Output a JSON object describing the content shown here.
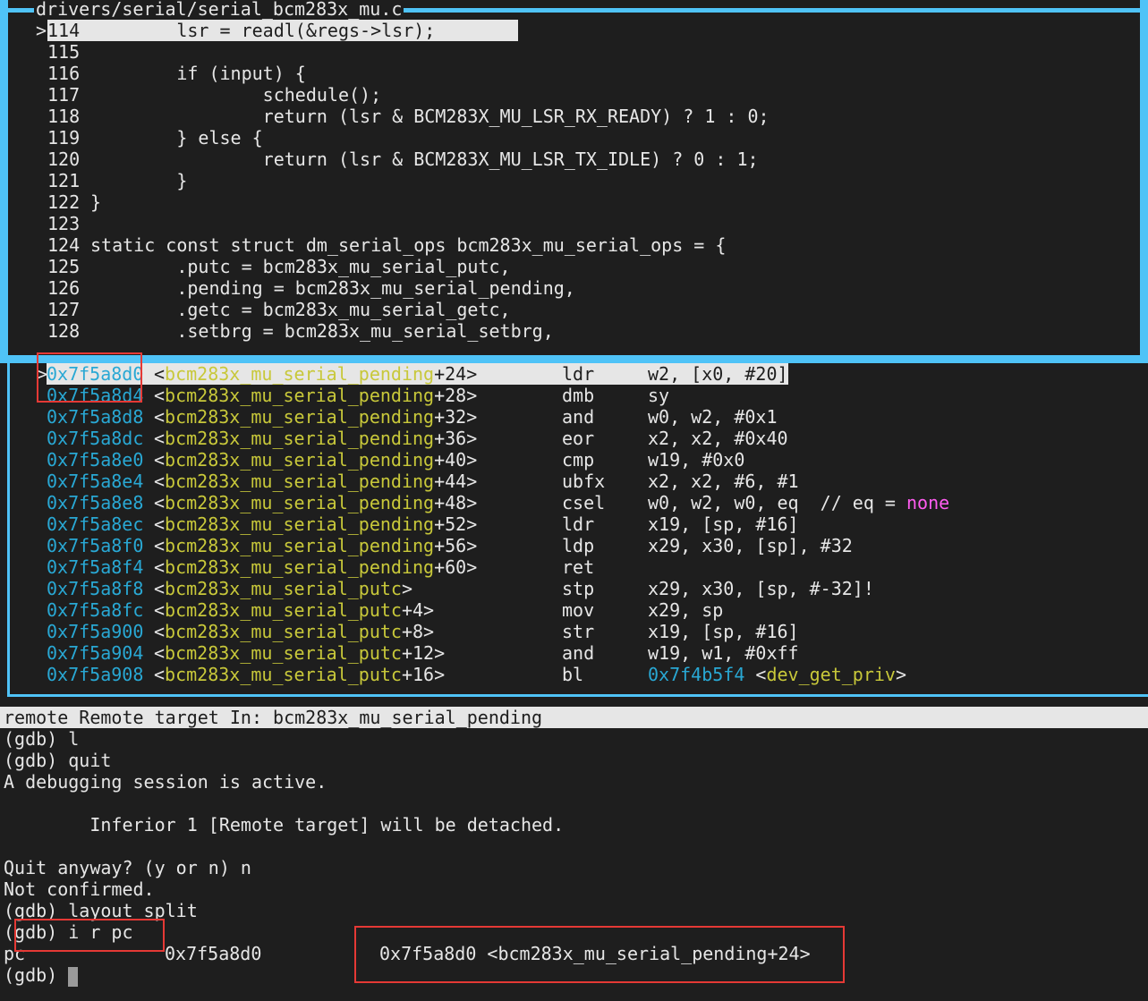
{
  "source": {
    "file": "drivers/serial/serial_bcm283x_mu.c",
    "current_marker": ">",
    "lines": [
      {
        "num": "114",
        "code": "        lsr = readl(&regs->lsr);"
      },
      {
        "num": "115",
        "code": ""
      },
      {
        "num": "116",
        "code": "        if (input) {"
      },
      {
        "num": "117",
        "code": "                schedule();"
      },
      {
        "num": "118",
        "code": "                return (lsr & BCM283X_MU_LSR_RX_READY) ? 1 : 0;"
      },
      {
        "num": "119",
        "code": "        } else {"
      },
      {
        "num": "120",
        "code": "                return (lsr & BCM283X_MU_LSR_TX_IDLE) ? 0 : 1;"
      },
      {
        "num": "121",
        "code": "        }"
      },
      {
        "num": "122",
        "code": "}"
      },
      {
        "num": "123",
        "code": ""
      },
      {
        "num": "124",
        "code": "static const struct dm_serial_ops bcm283x_mu_serial_ops = {"
      },
      {
        "num": "125",
        "code": "        .putc = bcm283x_mu_serial_putc,"
      },
      {
        "num": "126",
        "code": "        .pending = bcm283x_mu_serial_pending,"
      },
      {
        "num": "127",
        "code": "        .getc = bcm283x_mu_serial_getc,"
      },
      {
        "num": "128",
        "code": "        .setbrg = bcm283x_mu_serial_setbrg,"
      }
    ]
  },
  "asm": {
    "current_marker": ">",
    "rows": [
      {
        "addr": "0x7f5a8d0",
        "fn": "bcm283x_mu_serial_pending",
        "off": "+24>",
        "mn": "ldr",
        "op": "w2, [x0, #20]"
      },
      {
        "addr": "0x7f5a8d4",
        "fn": "bcm283x_mu_serial_pending",
        "off": "+28>",
        "mn": "dmb",
        "op": "sy"
      },
      {
        "addr": "0x7f5a8d8",
        "fn": "bcm283x_mu_serial_pending",
        "off": "+32>",
        "mn": "and",
        "op": "w0, w2, #0x1"
      },
      {
        "addr": "0x7f5a8dc",
        "fn": "bcm283x_mu_serial_pending",
        "off": "+36>",
        "mn": "eor",
        "op": "x2, x2, #0x40"
      },
      {
        "addr": "0x7f5a8e0",
        "fn": "bcm283x_mu_serial_pending",
        "off": "+40>",
        "mn": "cmp",
        "op": "w19, #0x0"
      },
      {
        "addr": "0x7f5a8e4",
        "fn": "bcm283x_mu_serial_pending",
        "off": "+44>",
        "mn": "ubfx",
        "op": "x2, x2, #6, #1"
      },
      {
        "addr": "0x7f5a8e8",
        "fn": "bcm283x_mu_serial_pending",
        "off": "+48>",
        "mn": "csel",
        "op": "w0, w2, w0, eq  // eq = ",
        "op_extra": "none"
      },
      {
        "addr": "0x7f5a8ec",
        "fn": "bcm283x_mu_serial_pending",
        "off": "+52>",
        "mn": "ldr",
        "op": "x19, [sp, #16]"
      },
      {
        "addr": "0x7f5a8f0",
        "fn": "bcm283x_mu_serial_pending",
        "off": "+56>",
        "mn": "ldp",
        "op": "x29, x30, [sp], #32"
      },
      {
        "addr": "0x7f5a8f4",
        "fn": "bcm283x_mu_serial_pending",
        "off": "+60>",
        "mn": "ret",
        "op": ""
      },
      {
        "addr": "0x7f5a8f8",
        "fn": "bcm283x_mu_serial_putc",
        "off": ">",
        "mn": "stp",
        "op": "x29, x30, [sp, #-32]!"
      },
      {
        "addr": "0x7f5a8fc",
        "fn": "bcm283x_mu_serial_putc",
        "off": "+4>",
        "mn": "mov",
        "op": "x29, sp"
      },
      {
        "addr": "0x7f5a900",
        "fn": "bcm283x_mu_serial_putc",
        "off": "+8>",
        "mn": "str",
        "op": "x19, [sp, #16]"
      },
      {
        "addr": "0x7f5a904",
        "fn": "bcm283x_mu_serial_putc",
        "off": "+12>",
        "mn": "and",
        "op": "w19, w1, #0xff"
      },
      {
        "addr": "0x7f5a908",
        "fn": "bcm283x_mu_serial_putc",
        "off": "+16>",
        "mn": "bl",
        "op_addr": "0x7f4b5f4",
        "op_sym": "dev_get_priv"
      }
    ]
  },
  "status": "remote Remote target In: bcm283x_mu_serial_pending",
  "console": [
    "(gdb) l",
    "(gdb) quit",
    "A debugging session is active.",
    "",
    "        Inferior 1 [Remote target] will be detached.",
    "",
    "Quit anyway? (y or n) n",
    "Not confirmed.",
    "(gdb) layout split",
    "(gdb) i r pc"
  ],
  "register": {
    "name": "pc",
    "hex": "0x7f5a8d0",
    "natural": "0x7f5a8d0 <bcm283x_mu_serial_pending+24>"
  },
  "prompt": "(gdb) ",
  "colors": {
    "border": "#4fc3f7",
    "address": "#29a8d4",
    "symbol": "#c8c83a",
    "keyword_none": "#ff5cf0",
    "annotation": "#e53935"
  }
}
